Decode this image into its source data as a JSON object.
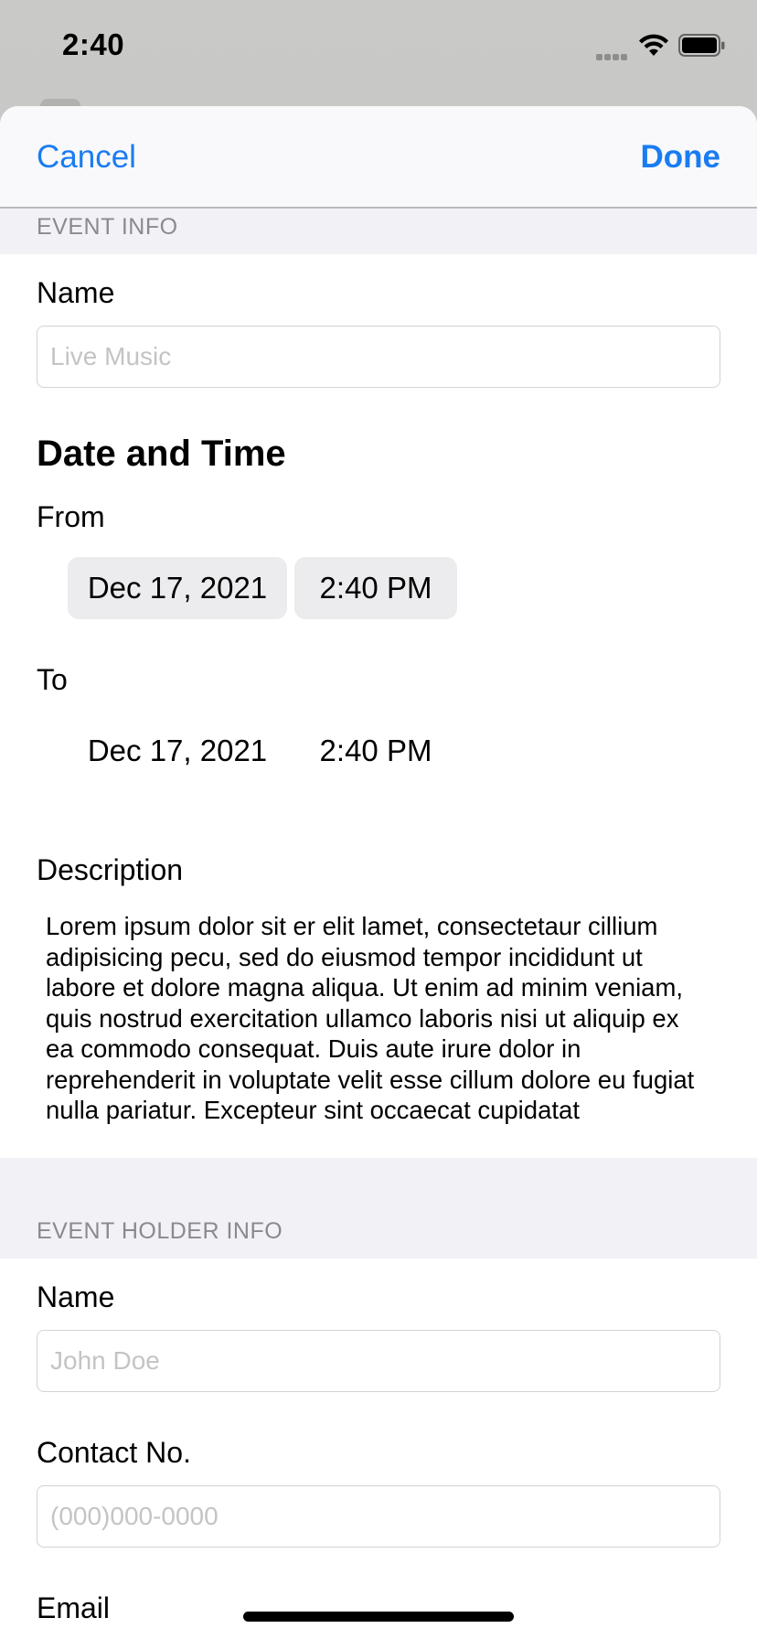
{
  "status_bar": {
    "time": "2:40",
    "icons": [
      "cellular-signal-icon",
      "wifi-icon",
      "battery-icon"
    ]
  },
  "nav": {
    "cancel_label": "Cancel",
    "done_label": "Done",
    "accent_color": "#1a7cf2"
  },
  "event_info": {
    "header": "EVENT INFO",
    "name_label": "Name",
    "name_placeholder": "Live Music",
    "date_time_title": "Date and Time",
    "from_label": "From",
    "from_date": "Dec 17, 2021",
    "from_time": "2:40 PM",
    "to_label": "To",
    "to_date": "Dec 17, 2021",
    "to_time": "2:40 PM",
    "description_label": "Description",
    "description_text": "Lorem ipsum dolor sit er elit lamet, consectetaur cillium adipisicing pecu, sed do eiusmod tempor incididunt ut labore et dolore magna aliqua. Ut enim ad minim veniam, quis nostrud exercitation ullamco laboris nisi ut aliquip ex ea commodo consequat. Duis aute irure dolor in reprehenderit in voluptate velit esse cillum dolore eu fugiat nulla pariatur. Excepteur sint occaecat cupidatat"
  },
  "event_holder_info": {
    "header": "EVENT HOLDER INFO",
    "name_label": "Name",
    "name_placeholder": "John Doe",
    "contact_label": "Contact No.",
    "contact_placeholder": "(000)000-0000",
    "email_label": "Email"
  }
}
